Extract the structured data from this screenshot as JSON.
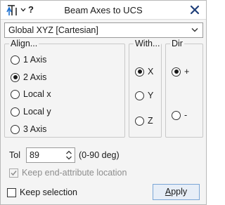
{
  "window": {
    "title": "Beam Axes to UCS",
    "help_label": "?"
  },
  "coordinate_system": {
    "selected": "Global XYZ [Cartesian]"
  },
  "align": {
    "label": "Align...",
    "options": [
      {
        "label": "1 Axis",
        "selected": false
      },
      {
        "label": "2 Axis",
        "selected": true
      },
      {
        "label": "Local x",
        "selected": false
      },
      {
        "label": "Local y",
        "selected": false
      },
      {
        "label": "3 Axis",
        "selected": false
      }
    ]
  },
  "with": {
    "label": "With...",
    "options": [
      {
        "label": "X",
        "selected": true
      },
      {
        "label": "Y",
        "selected": false
      },
      {
        "label": "Z",
        "selected": false
      }
    ]
  },
  "dir": {
    "label": "Dir",
    "options": [
      {
        "label": "+",
        "selected": true
      },
      {
        "label": "-",
        "selected": false
      }
    ]
  },
  "tolerance": {
    "label": "Tol",
    "value": "89",
    "unit": "(0-90 deg)"
  },
  "keep_end_attribute": {
    "label": "Keep end-attribute location",
    "checked": true,
    "enabled": false
  },
  "keep_selection": {
    "label": "Keep selection",
    "checked": false
  },
  "apply": {
    "label_first": "A",
    "label_rest": "pply"
  }
}
